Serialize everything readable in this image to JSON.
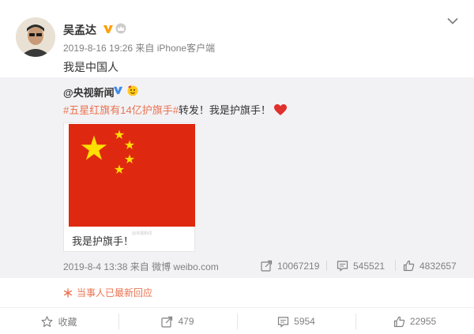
{
  "post": {
    "author_name": "吴孟达",
    "meta": "2019-8-16 19:26 来自 iPhone客户端",
    "text": "我是中国人"
  },
  "repost": {
    "author": "@央视新闻",
    "hashtag": "#五星红旗有14亿护旗手#",
    "text_after": "转发！我是护旗手！",
    "card_caption": "我是护旗手！",
    "card_watermark": "@央视新闻",
    "date": "2019-8-4 13:38 来自 微博 weibo.com",
    "forward_count": "10067219",
    "comment_count": "545521",
    "like_count": "4832657"
  },
  "reply_note": "当事人已最新回应",
  "actions": {
    "favorite_label": "收藏",
    "forward_count": "479",
    "comment_count": "5954",
    "like_count": "22955"
  },
  "colors": {
    "accent": "#eb7350",
    "verified_badge": "#ffa00a",
    "flag_red": "#de2910",
    "flag_star": "#ffde00",
    "heart": "#e0302b"
  }
}
